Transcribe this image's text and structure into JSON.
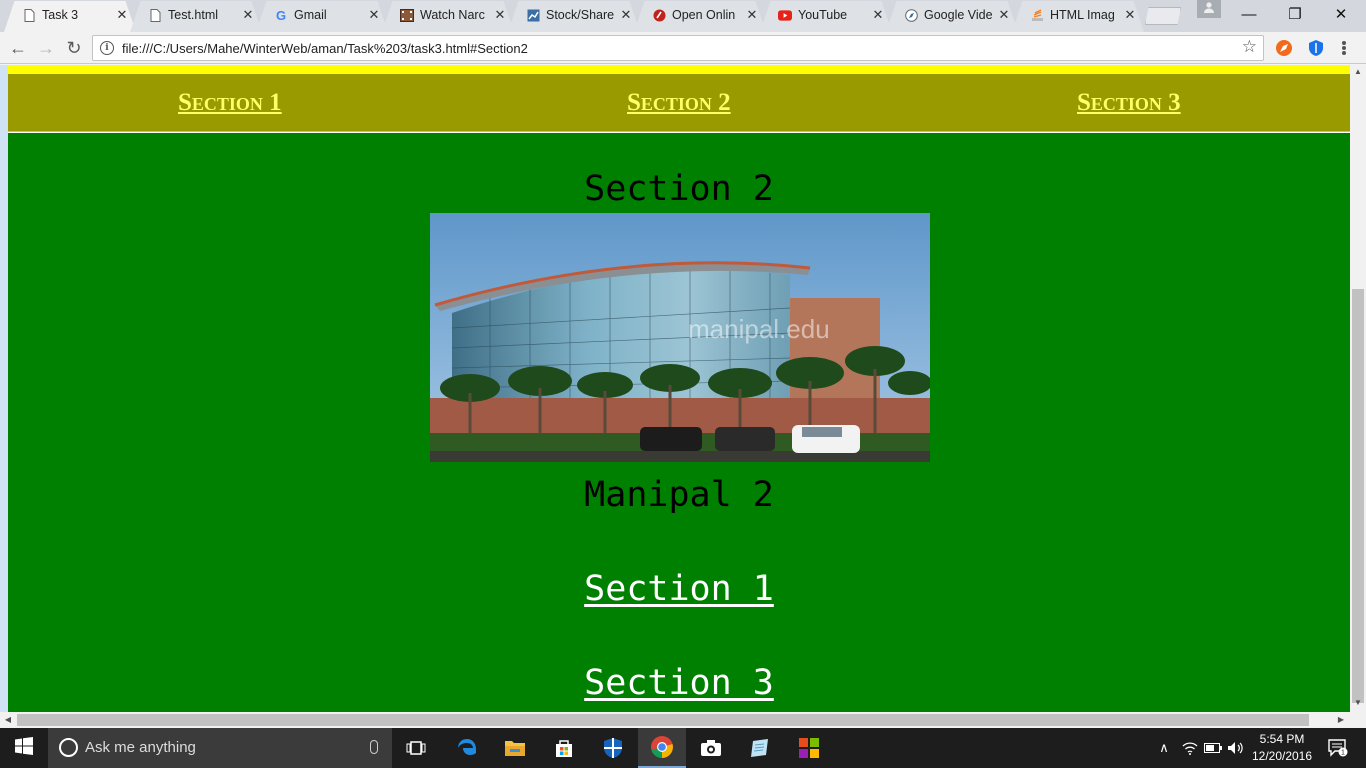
{
  "browser": {
    "tabs": [
      {
        "title": "Task 3",
        "icon": "page-icon",
        "active": true
      },
      {
        "title": "Test.html",
        "icon": "page-icon",
        "active": false
      },
      {
        "title": "Gmail",
        "icon": "google-icon",
        "active": false
      },
      {
        "title": "Watch Narc",
        "icon": "film-icon",
        "active": false
      },
      {
        "title": "Stock/Share",
        "icon": "chart-icon",
        "active": false
      },
      {
        "title": "Open Onlin",
        "icon": "pen-icon",
        "active": false
      },
      {
        "title": "YouTube",
        "icon": "youtube-icon",
        "active": false
      },
      {
        "title": "Google Vide",
        "icon": "compass-icon",
        "active": false
      },
      {
        "title": "HTML Imag",
        "icon": "stack-icon",
        "active": false
      }
    ],
    "close_glyph": "✕",
    "window_controls": {
      "minimize": "—",
      "maximize": "❐",
      "close": "✕"
    },
    "toolbar": {
      "back_glyph": "←",
      "forward_glyph": "→",
      "reload_glyph": "↻",
      "info_glyph": "i",
      "url": "file:///C:/Users/Mahe/WinterWeb/aman/Task%203/task3.html#Section2",
      "star_glyph": "☆"
    }
  },
  "page": {
    "colors": {
      "topline": "#ffff00",
      "navbar": "#999900",
      "navlink": "#ffff66",
      "content": "#008000",
      "link": "#ffffff"
    },
    "nav": [
      "Section 1",
      "Section 2",
      "Section 3"
    ],
    "heading": "Section 2",
    "photo_alt": "Manipal building",
    "photo_watermark": "manipal.edu",
    "caption": "Manipal 2",
    "links": [
      "Section 1",
      "Section 3"
    ]
  },
  "taskbar": {
    "search_placeholder": "Ask me anything",
    "apps": [
      "task-view-icon",
      "edge-icon",
      "file-explorer-icon",
      "store-icon",
      "defender-icon",
      "chrome-icon",
      "camera-icon",
      "notes-icon",
      "office-icon"
    ],
    "time": "5:54 PM",
    "date": "12/20/2016",
    "notification_count": "1",
    "tray_chevron": "∧"
  }
}
